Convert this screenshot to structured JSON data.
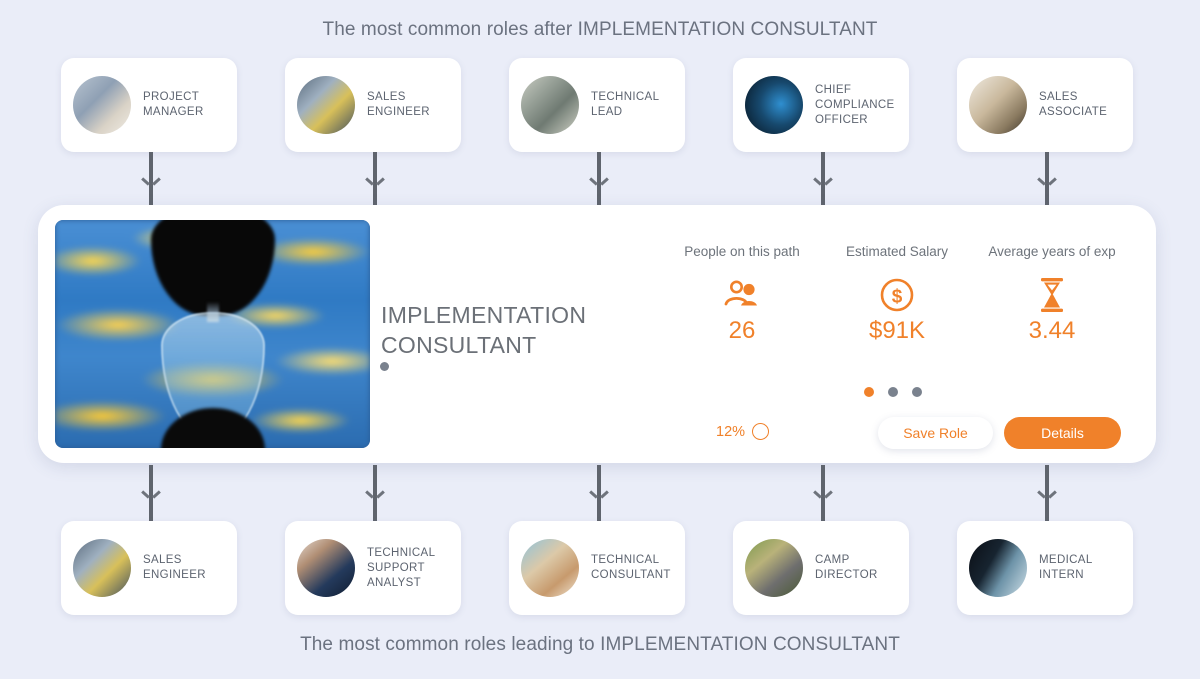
{
  "headings": {
    "top": "The most common roles after IMPLEMENTATION CONSULTANT",
    "bottom": "The most common roles leading to IMPLEMENTATION CONSULTANT"
  },
  "next_roles": [
    {
      "label": "PROJECT\nMANAGER",
      "image": "project-manager-photo"
    },
    {
      "label": "SALES\nENGINEER",
      "image": "sales-engineer-photo"
    },
    {
      "label": "TECHNICAL\nLEAD",
      "image": "technical-lead-photo"
    },
    {
      "label": "CHIEF\nCOMPLIANCE\nOFFICER",
      "image": "chief-compliance-officer-photo"
    },
    {
      "label": "SALES\nASSOCIATE",
      "image": "sales-associate-photo"
    }
  ],
  "previous_roles": [
    {
      "label": "SALES\nENGINEER",
      "image": "sales-engineer-photo"
    },
    {
      "label": "TECHNICAL\nSUPPORT\nANALYST",
      "image": "technical-support-analyst-photo"
    },
    {
      "label": "TECHNICAL\nCONSULTANT",
      "image": "technical-consultant-photo"
    },
    {
      "label": "CAMP\nDIRECTOR",
      "image": "camp-director-photo"
    },
    {
      "label": "MEDICAL\nINTERN",
      "image": "medical-intern-photo"
    }
  ],
  "main_card": {
    "title": "IMPLEMENTATION\nCONSULTANT",
    "image": "hourglass-sky-photo",
    "stats": [
      {
        "label": "People on this path",
        "value": "26",
        "icon": "people-icon"
      },
      {
        "label": "Estimated Salary",
        "value": "$91K",
        "icon": "dollar-circle-icon"
      },
      {
        "label": "Average years of exp",
        "value": "3.44",
        "icon": "hourglass-icon"
      }
    ],
    "match_percent": "12%",
    "carousel": {
      "total": 3,
      "active_index": 0
    },
    "save_label": "Save Role",
    "details_label": "Details"
  },
  "colors": {
    "accent": "#f0812a",
    "background": "#eaedf8",
    "card": "#ffffff",
    "text_muted": "#6b7280",
    "arrow": "#5f646d"
  }
}
